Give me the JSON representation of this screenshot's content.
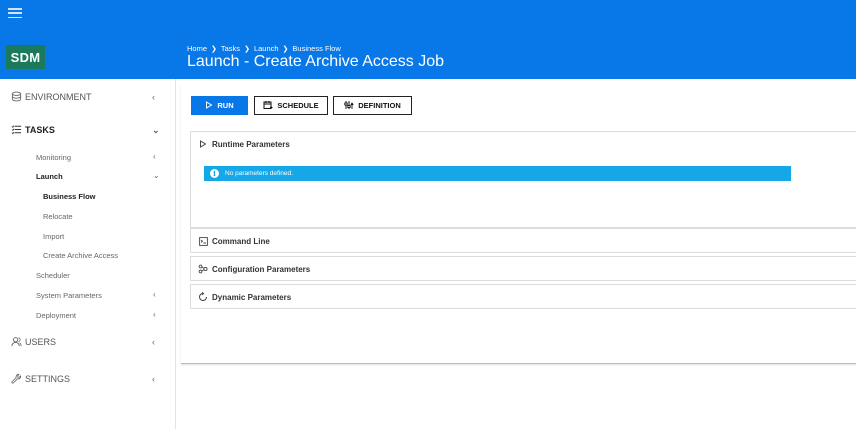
{
  "app": {
    "logo": "SDM"
  },
  "header": {
    "breadcrumb": [
      "Home",
      "Tasks",
      "Launch",
      "Business Flow"
    ],
    "title": "Launch - Create Archive Access Job"
  },
  "sidebar": {
    "sections": {
      "environment": {
        "label": "ENVIRONMENT",
        "icon": "database-icon"
      },
      "tasks": {
        "label": "TASKS",
        "icon": "list-icon"
      },
      "users": {
        "label": "USERS",
        "icon": "users-icon"
      },
      "settings": {
        "label": "SETTINGS",
        "icon": "wrench-icon"
      }
    },
    "task_items": {
      "monitoring": "Monitoring",
      "launch": "Launch",
      "business_flow": "Business Flow",
      "relocate": "Relocate",
      "import": "Import",
      "create_archive_access": "Create Archive Access",
      "scheduler": "Scheduler",
      "system_parameters": "System Parameters",
      "deployment": "Deployment"
    }
  },
  "toolbar": {
    "run": "RUN",
    "schedule": "SCHEDULE",
    "definition": "DEFINITION"
  },
  "panels": {
    "runtime": "Runtime Parameters",
    "command_line": "Command Line",
    "configuration": "Configuration Parameters",
    "dynamic": "Dynamic Parameters"
  },
  "info": {
    "message": "No parameters defined."
  },
  "colors": {
    "primary": "#0877e8",
    "logo_bg": "#1a7a5b",
    "info_bg": "#16a8e6"
  }
}
